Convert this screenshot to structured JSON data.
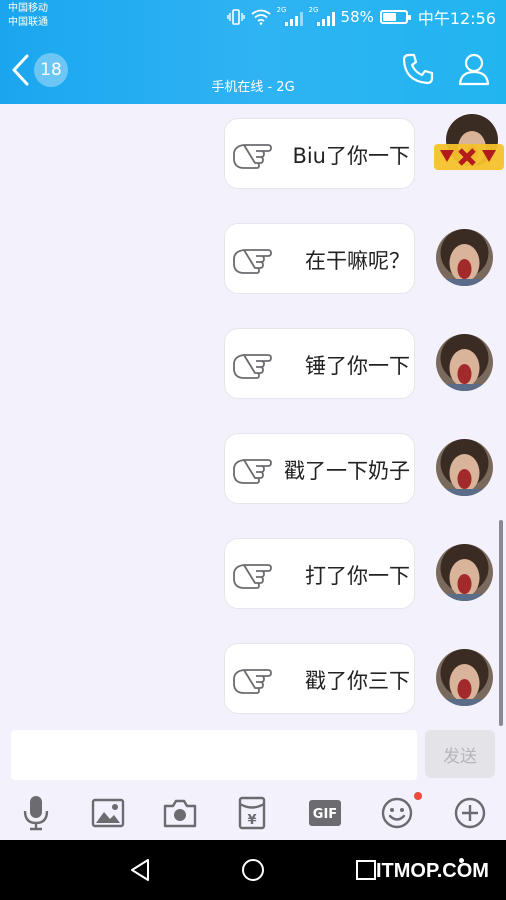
{
  "status_bar": {
    "carrier_1": "中国移动",
    "carrier_2": "中国联通",
    "signal_1_label": "2G",
    "signal_2_label": "2G",
    "battery_percent": "58%",
    "battery_level": 0.58,
    "time": "中午12:56"
  },
  "header": {
    "unread_count": "18",
    "subtitle": "手机在线 - 2G"
  },
  "messages": [
    {
      "text": "Biu了你一下",
      "avatar": "sticker-avatar"
    },
    {
      "text": "在干嘛呢？",
      "avatar": "user-avatar"
    },
    {
      "text": "锤了你一下",
      "avatar": "user-avatar"
    },
    {
      "text": "戳了一下奶子",
      "avatar": "user-avatar"
    },
    {
      "text": "打了你一下",
      "avatar": "user-avatar"
    },
    {
      "text": "戳了你三下",
      "avatar": "user-avatar"
    }
  ],
  "input": {
    "value": "",
    "placeholder": "",
    "send_label": "发送"
  },
  "toolbar": {
    "items": [
      "mic-icon",
      "image-icon",
      "camera-icon",
      "red-packet-icon",
      "gif-icon",
      "emoji-icon",
      "plus-icon"
    ],
    "gif_label": "GIF",
    "yen_symbol": "¥"
  },
  "watermark": "ITMOP.COM",
  "colors": {
    "header_gradient_start": "#1aa6ef",
    "header_gradient_end": "#21b5f0",
    "chat_background": "#f3f1fb",
    "icon_gray": "#6b6b70",
    "notification_dot": "#f04a3c"
  }
}
